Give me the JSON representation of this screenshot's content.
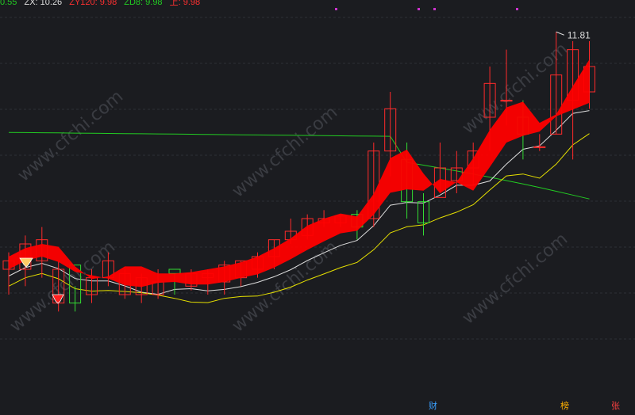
{
  "theme": {
    "background": "#1b1c20",
    "up_color": "#ff2a2a",
    "down_color": "#33dd33",
    "ribbon_color": "#ff0000",
    "ma_long_color": "#22cc22",
    "ma_mid_color": "#dddddd",
    "ma_low_color": "#e6e000",
    "grid_color": "#2e3036",
    "marker_color": "#cc33cc"
  },
  "legend": [
    {
      "text": "0.55",
      "color": "#22cc22"
    },
    {
      "text": "ZX: 10.26",
      "color": "#dddddd"
    },
    {
      "text": "ZY120: 9.98",
      "color": "#ff3030"
    },
    {
      "text": "ZD8: 9.98",
      "color": "#22cc22"
    },
    {
      "text": "上: 9.98",
      "color": "#ff3030"
    }
  ],
  "flags": [
    {
      "text": "财",
      "color": "#3aa0ff"
    },
    {
      "text": "榜",
      "color": "#ffb000"
    },
    {
      "text": "张",
      "color": "#ff4040"
    }
  ],
  "watermark": "www.cfchi.com",
  "chart_data": {
    "type": "candlestick",
    "ylim": [
      7.5,
      12.0
    ],
    "grid": "horizontal",
    "annotations": [
      {
        "text": "11.81",
        "at_index": 33,
        "value": 11.81
      }
    ],
    "candles": [
      {
        "o": 9.0,
        "h": 9.2,
        "l": 8.7,
        "c": 9.1
      },
      {
        "o": 9.0,
        "h": 9.4,
        "l": 8.8,
        "c": 9.3
      },
      {
        "o": 9.1,
        "h": 9.5,
        "l": 8.9,
        "c": 9.35
      },
      {
        "o": 8.6,
        "h": 9.1,
        "l": 8.5,
        "c": 9.0
      },
      {
        "o": 9.05,
        "h": 8.8,
        "l": 8.5,
        "c": 8.6
      },
      {
        "o": 8.7,
        "h": 9.0,
        "l": 8.6,
        "c": 8.9
      },
      {
        "o": 8.9,
        "h": 9.2,
        "l": 8.8,
        "c": 9.1
      },
      {
        "o": 8.7,
        "h": 9.0,
        "l": 8.65,
        "c": 8.95
      },
      {
        "o": 8.7,
        "h": 8.95,
        "l": 8.6,
        "c": 8.9
      },
      {
        "o": 8.7,
        "h": 9.0,
        "l": 8.65,
        "c": 8.85
      },
      {
        "o": 9.0,
        "h": 8.95,
        "l": 8.7,
        "c": 8.95
      },
      {
        "o": 8.8,
        "h": 9.0,
        "l": 8.75,
        "c": 8.95
      },
      {
        "o": 8.9,
        "h": 9.0,
        "l": 8.7,
        "c": 8.95
      },
      {
        "o": 8.85,
        "h": 9.1,
        "l": 8.7,
        "c": 9.05
      },
      {
        "o": 8.9,
        "h": 9.1,
        "l": 8.8,
        "c": 9.1
      },
      {
        "o": 9.0,
        "h": 9.2,
        "l": 8.9,
        "c": 9.15
      },
      {
        "o": 9.15,
        "h": 9.35,
        "l": 9.0,
        "c": 9.35
      },
      {
        "o": 9.35,
        "h": 9.6,
        "l": 9.3,
        "c": 9.45
      },
      {
        "o": 9.4,
        "h": 9.65,
        "l": 9.35,
        "c": 9.6
      },
      {
        "o": 9.55,
        "h": 9.7,
        "l": 9.5,
        "c": 9.6
      },
      {
        "o": 9.55,
        "h": 9.65,
        "l": 9.5,
        "c": 9.63
      },
      {
        "o": 9.65,
        "h": 9.7,
        "l": 9.35,
        "c": 9.5
      },
      {
        "o": 9.6,
        "h": 10.5,
        "l": 9.5,
        "c": 10.4
      },
      {
        "o": 10.4,
        "h": 11.1,
        "l": 10.1,
        "c": 10.9
      },
      {
        "o": 10.3,
        "h": 10.5,
        "l": 9.6,
        "c": 9.8
      },
      {
        "o": 9.8,
        "h": 9.9,
        "l": 9.4,
        "c": 9.55
      },
      {
        "o": 9.85,
        "h": 10.5,
        "l": 9.9,
        "c": 10.2
      },
      {
        "o": 10.05,
        "h": 10.4,
        "l": 9.9,
        "c": 10.2
      },
      {
        "o": 10.2,
        "h": 10.5,
        "l": 10.0,
        "c": 10.4
      },
      {
        "o": 10.8,
        "h": 11.4,
        "l": 10.4,
        "c": 11.2
      },
      {
        "o": 11.0,
        "h": 11.6,
        "l": 10.7,
        "c": 11.0
      },
      {
        "o": 10.8,
        "h": 11.0,
        "l": 10.3,
        "c": 10.6
      },
      {
        "o": 10.45,
        "h": 10.6,
        "l": 10.4,
        "c": 10.45
      },
      {
        "o": 10.6,
        "h": 11.81,
        "l": 10.6,
        "c": 11.3
      },
      {
        "o": 11.0,
        "h": 11.7,
        "l": 10.3,
        "c": 11.6
      },
      {
        "o": 11.1,
        "h": 11.7,
        "l": 10.9,
        "c": 11.4
      }
    ]
  }
}
